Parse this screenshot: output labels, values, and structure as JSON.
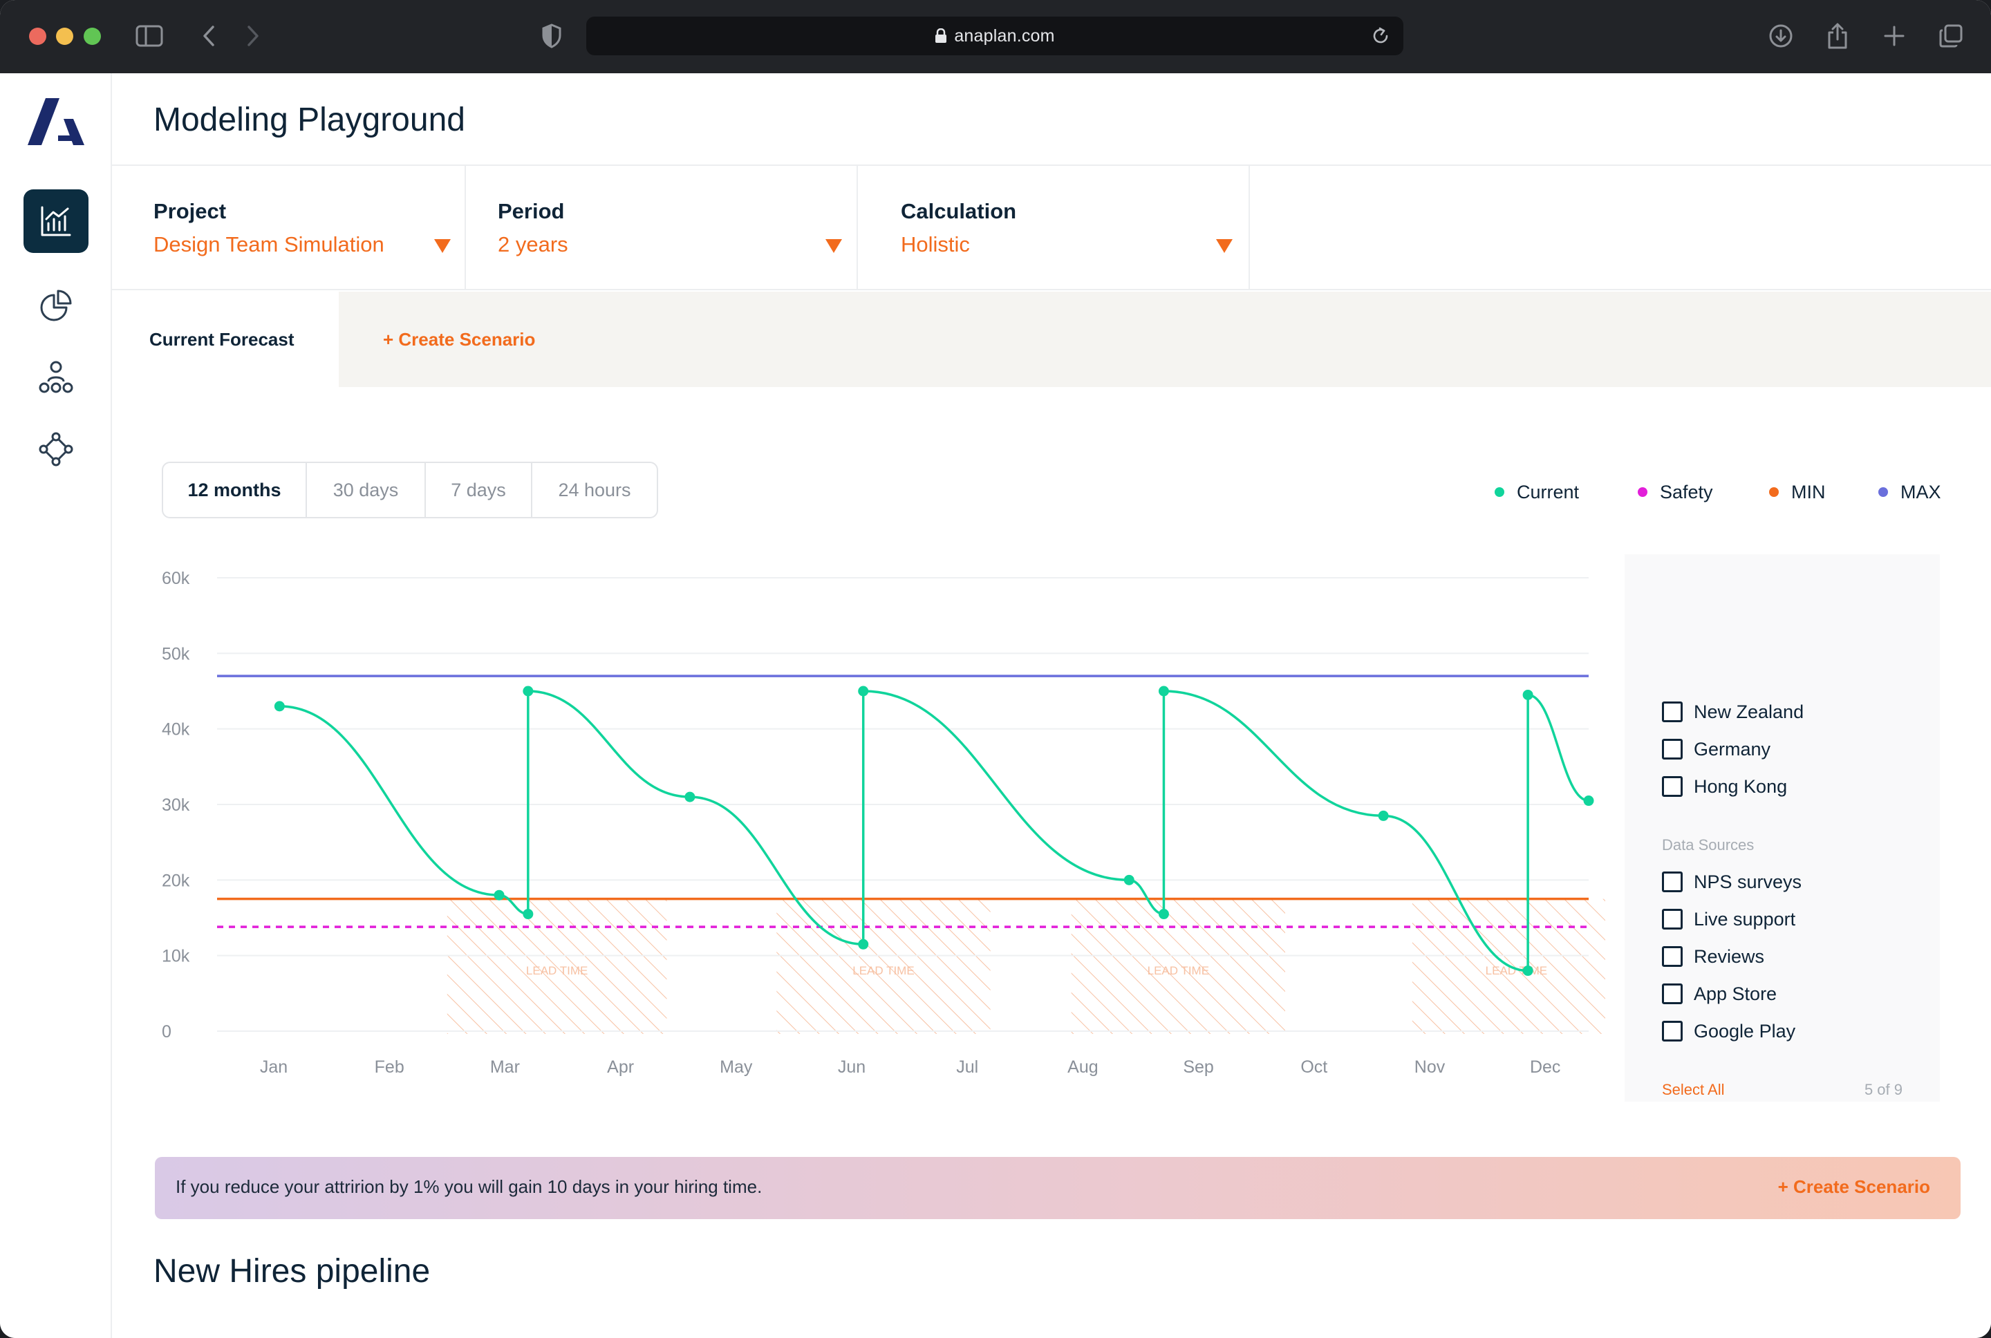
{
  "browser": {
    "url": "anaplan.com"
  },
  "page": {
    "title": "Modeling Playground",
    "section_title": "New Hires pipeline"
  },
  "filters": [
    {
      "label": "Project",
      "value": "Design Team Simulation"
    },
    {
      "label": "Period",
      "value": "2 years"
    },
    {
      "label": "Calculation",
      "value": "Holistic"
    }
  ],
  "tabs": {
    "current": "Current Forecast",
    "create": "+ Create Scenario"
  },
  "ranges": [
    "12 months",
    "30 days",
    "7 days",
    "24 hours"
  ],
  "range_selected": "12 months",
  "legend": [
    {
      "name": "Current",
      "color": "#10d49b"
    },
    {
      "name": "Safety",
      "color": "#e21fd9"
    },
    {
      "name": "MIN",
      "color": "#f26b1d"
    },
    {
      "name": "MAX",
      "color": "#6a6fdc"
    }
  ],
  "chart_data": {
    "type": "line",
    "x": [
      "Jan",
      "Feb",
      "Mar",
      "Apr",
      "May",
      "Jun",
      "Jul",
      "Aug",
      "Sep",
      "Oct",
      "Nov",
      "Dec"
    ],
    "ylim": [
      0,
      60000
    ],
    "y_ticks": [
      {
        "value": 0,
        "label": "0"
      },
      {
        "value": 10000,
        "label": "10k"
      },
      {
        "value": 20000,
        "label": "20k"
      },
      {
        "value": 30000,
        "label": "30k"
      },
      {
        "value": 40000,
        "label": "40k"
      },
      {
        "value": 50000,
        "label": "50k"
      },
      {
        "value": 60000,
        "label": "60k"
      }
    ],
    "grid": true,
    "series": [
      {
        "name": "Current",
        "color": "#10d49b",
        "points": [
          {
            "x": 0.55,
            "y": 43000
          },
          {
            "x": 2.45,
            "y": 18000
          },
          {
            "x": 2.7,
            "y": 15500
          },
          {
            "x": 2.7,
            "y": 45000
          },
          {
            "x": 4.1,
            "y": 31000
          },
          {
            "x": 5.6,
            "y": 11500
          },
          {
            "x": 5.6,
            "y": 45000
          },
          {
            "x": 7.9,
            "y": 20000
          },
          {
            "x": 8.2,
            "y": 15500
          },
          {
            "x": 8.2,
            "y": 45000
          },
          {
            "x": 10.1,
            "y": 28500
          },
          {
            "x": 11.35,
            "y": 8000
          },
          {
            "x": 11.35,
            "y": 44500
          },
          {
            "x": 12.55,
            "y": 30500
          }
        ]
      }
    ],
    "reference_lines": [
      {
        "name": "MAX",
        "y": 47000,
        "color": "#6a6fdc",
        "style": "solid"
      },
      {
        "name": "MIN",
        "y": 17500,
        "color": "#f26b1d",
        "style": "solid"
      },
      {
        "name": "Safety",
        "y": 13800,
        "color": "#e21fd9",
        "style": "dashed"
      }
    ],
    "bands": [
      {
        "label": "LEAD TIME",
        "x_start": 2.0,
        "x_end": 3.9
      },
      {
        "label": "LEAD TIME",
        "x_start": 4.85,
        "x_end": 6.7
      },
      {
        "label": "LEAD TIME",
        "x_start": 7.4,
        "x_end": 9.25
      },
      {
        "label": "LEAD TIME",
        "x_start": 10.35,
        "x_end": 12.15
      }
    ]
  },
  "panel": {
    "regions": [
      "New Zealand",
      "Germany",
      "Hong Kong"
    ],
    "data_sources_label": "Data Sources",
    "data_sources": [
      "NPS surveys",
      "Live support",
      "Reviews",
      "App Store",
      "Google Play"
    ],
    "select_all": "Select All",
    "count": "5 of 9"
  },
  "banner": {
    "text": "If you reduce your attririon by 1% you will gain 10 days in your hiring time.",
    "cta": "+ Create Scenario"
  }
}
